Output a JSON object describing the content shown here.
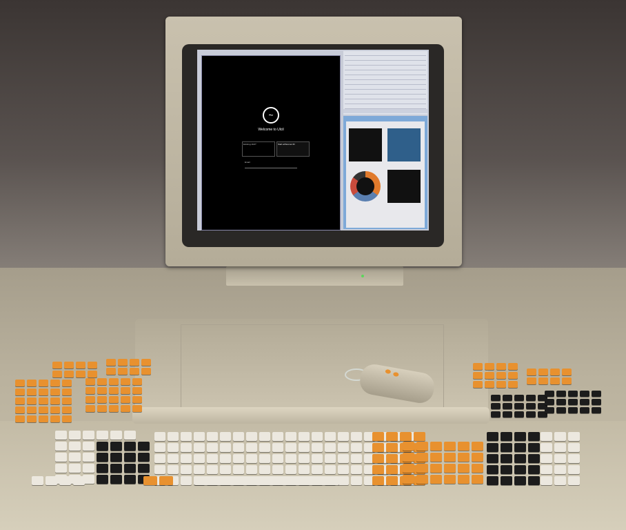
{
  "scene": {
    "brand_label": "",
    "screen": {
      "welcome_text": "Welcome to Ulcil",
      "logo_glyph": "~",
      "card_left": "Existing Ulcil?",
      "card_right": "Start without an ID",
      "field_label": "Email"
    }
  },
  "colors": {
    "orange_key": "#e8912f",
    "white_key": "#ece8df",
    "black_key": "#1c1c1c",
    "beige_body": "#c9c1ae",
    "screen_accent": "#7ea9d8"
  }
}
